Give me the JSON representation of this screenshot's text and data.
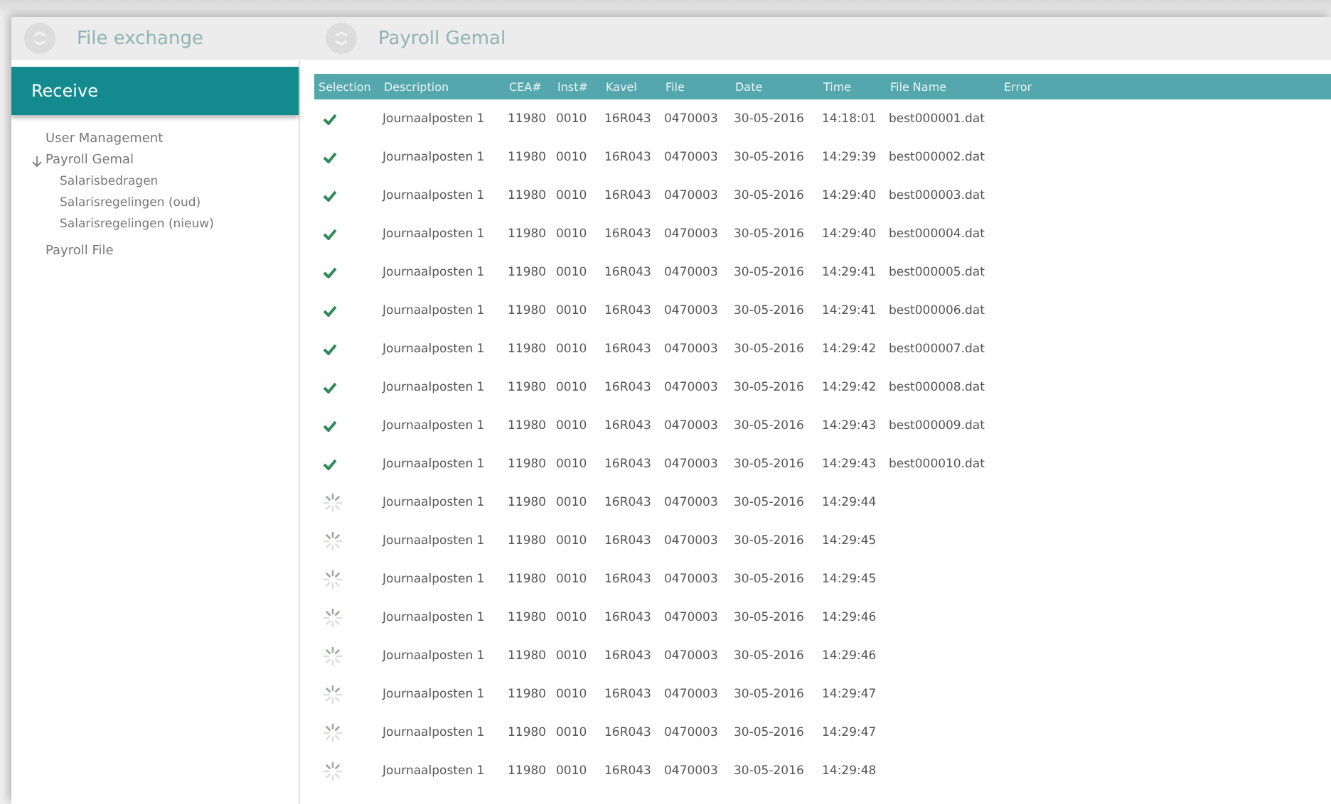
{
  "header": {
    "left_title": "File exchange",
    "right_title": "Payroll Gemal"
  },
  "sidebar": {
    "section": "Receive",
    "items": [
      {
        "label": "User Management",
        "expanded": false
      },
      {
        "label": "Payroll Gemal",
        "expanded": true,
        "children": [
          {
            "label": "Salarisbedragen"
          },
          {
            "label": "Salarisregelingen (oud)"
          },
          {
            "label": "Salarisregelingen (nieuw)"
          }
        ]
      },
      {
        "label": "Payroll File",
        "expanded": false
      }
    ]
  },
  "table": {
    "columns": [
      "Selection",
      "Description",
      "CEA#",
      "Inst#",
      "Kavel",
      "File",
      "Date",
      "Time",
      "File Name",
      "Error"
    ],
    "rows": [
      {
        "completed": true,
        "cells": [
          "",
          "Journaalposten 1",
          "11980",
          "0010",
          "16R043",
          "0470003",
          "30-05-2016",
          "14:18:01",
          "best000001.dat"
        ]
      },
      {
        "completed": true,
        "cells": [
          "",
          "Journaalposten 1",
          "11980",
          "0010",
          "16R043",
          "0470003",
          "30-05-2016",
          "14:29:39",
          "best000002.dat"
        ]
      },
      {
        "completed": true,
        "cells": [
          "",
          "Journaalposten 1",
          "11980",
          "0010",
          "16R043",
          "0470003",
          "30-05-2016",
          "14:29:40",
          "best000003.dat"
        ]
      },
      {
        "completed": true,
        "cells": [
          "",
          "Journaalposten 1",
          "11980",
          "0010",
          "16R043",
          "0470003",
          "30-05-2016",
          "14:29:40",
          "best000004.dat"
        ]
      },
      {
        "completed": true,
        "cells": [
          "",
          "Journaalposten 1",
          "11980",
          "0010",
          "16R043",
          "0470003",
          "30-05-2016",
          "14:29:41",
          "best000005.dat"
        ]
      },
      {
        "completed": true,
        "cells": [
          "",
          "Journaalposten 1",
          "11980",
          "0010",
          "16R043",
          "0470003",
          "30-05-2016",
          "14:29:41",
          "best000006.dat"
        ]
      },
      {
        "completed": true,
        "cells": [
          "",
          "Journaalposten 1",
          "11980",
          "0010",
          "16R043",
          "0470003",
          "30-05-2016",
          "14:29:42",
          "best000007.dat"
        ]
      },
      {
        "completed": true,
        "cells": [
          "",
          "Journaalposten 1",
          "11980",
          "0010",
          "16R043",
          "0470003",
          "30-05-2016",
          "14:29:42",
          "best000008.dat"
        ]
      },
      {
        "completed": true,
        "cells": [
          "",
          "Journaalposten 1",
          "11980",
          "0010",
          "16R043",
          "0470003",
          "30-05-2016",
          "14:29:43",
          "best000009.dat"
        ]
      },
      {
        "completed": true,
        "cells": [
          "",
          "Journaalposten 1",
          "11980",
          "0010",
          "16R043",
          "0470003",
          "30-05-2016",
          "14:29:43",
          "best000010.dat"
        ]
      },
      {
        "completed": false,
        "cells": [
          "",
          "Journaalposten 1",
          "11980",
          "0010",
          "16R043",
          "0470003",
          "30-05-2016",
          "14:29:44"
        ]
      },
      {
        "completed": false,
        "cells": [
          "",
          "Journaalposten 1",
          "11980",
          "0010",
          "16R043",
          "0470003",
          "30-05-2016",
          "14:29:45"
        ]
      },
      {
        "completed": false,
        "cells": [
          "",
          "Journaalposten 1",
          "11980",
          "0010",
          "16R043",
          "0470003",
          "30-05-2016",
          "14:29:45"
        ]
      },
      {
        "completed": false,
        "cells": [
          "",
          "Journaalposten 1",
          "11980",
          "0010",
          "16R043",
          "0470003",
          "30-05-2016",
          "14:29:46"
        ]
      },
      {
        "completed": false,
        "cells": [
          "",
          "Journaalposten 1",
          "11980",
          "0010",
          "16R043",
          "0470003",
          "30-05-2016",
          "14:29:46"
        ]
      },
      {
        "completed": false,
        "cells": [
          "",
          "Journaalposten 1",
          "11980",
          "0010",
          "16R043",
          "0470003",
          "30-05-2016",
          "14:29:47"
        ]
      },
      {
        "completed": false,
        "cells": [
          "",
          "Journaalposten 1",
          "11980",
          "0010",
          "16R043",
          "0470003",
          "30-05-2016",
          "14:29:47"
        ]
      },
      {
        "completed": false,
        "cells": [
          "",
          "Journaalposten 1",
          "11980",
          "0010",
          "16R043",
          "0470003",
          "30-05-2016",
          "14:29:48"
        ]
      }
    ]
  }
}
